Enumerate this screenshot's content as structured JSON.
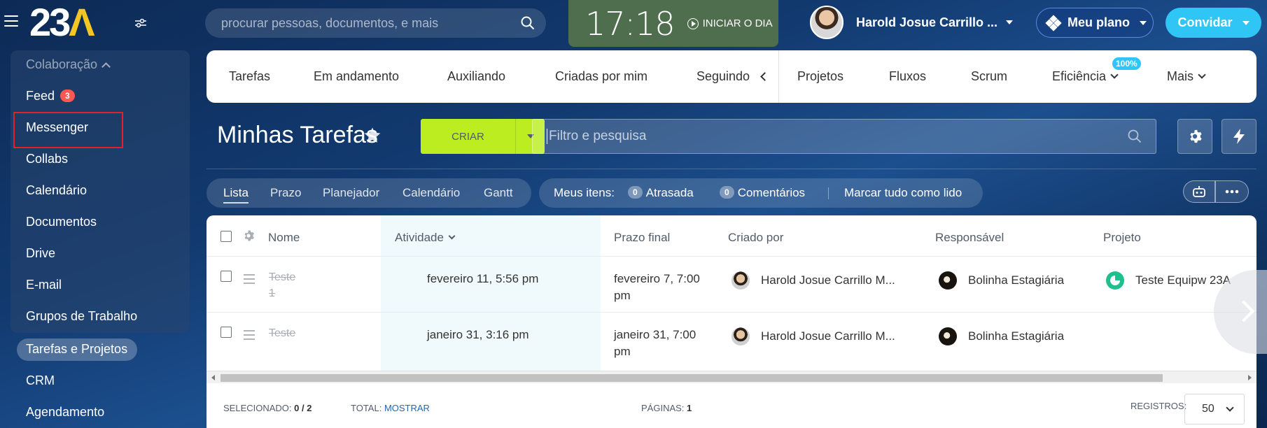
{
  "header": {
    "logo": {
      "main": "23",
      "accent": "Λ"
    },
    "search_placeholder": "procurar pessoas, documentos, e mais",
    "clock_time": "17:18",
    "start_day_label": "INICIAR O DIA",
    "user_name": "Harold Josue Carrillo ...",
    "plan_label": "Meu plano",
    "invite_label": "Convidar"
  },
  "sidebar": {
    "group_label": "Colaboração",
    "feed_label": "Feed",
    "feed_badge": "3",
    "items": [
      "Messenger",
      "Collabs",
      "Calendário",
      "Documentos",
      "Drive",
      "E-mail",
      "Grupos de Trabalho"
    ],
    "active_item": "Tarefas e Projetos",
    "below_items": [
      "CRM",
      "Agendamento"
    ]
  },
  "navbar": {
    "left_tabs": [
      "Tarefas",
      "Em andamento",
      "Auxiliando",
      "Criadas por mim",
      "Seguindo"
    ],
    "right_tabs": [
      "Projetos",
      "Fluxos",
      "Scrum"
    ],
    "efficiency_label": "Eficiência",
    "efficiency_badge": "100%",
    "more_label": "Mais"
  },
  "page": {
    "title": "Minhas Tarefas",
    "create_label": "CRIAR",
    "filter_placeholder": "Filtro e pesquisa"
  },
  "views": {
    "tabs": [
      "Lista",
      "Prazo",
      "Planejador",
      "Calendário",
      "Gantt"
    ],
    "active": "Lista"
  },
  "counters": {
    "label": "Meus itens:",
    "overdue_count": "0",
    "overdue_label": "Atrasada",
    "comments_count": "0",
    "comments_label": "Comentários",
    "mark_read_label": "Marcar tudo como lido"
  },
  "table": {
    "headers": {
      "name": "Nome",
      "activity": "Atividade",
      "deadline": "Prazo final",
      "created_by": "Criado por",
      "responsible": "Responsável",
      "project": "Projeto"
    },
    "rows": [
      {
        "name_line1": "Teste",
        "name_line2": "1",
        "activity": "fevereiro 11, 5:56 pm",
        "deadline_line1": "fevereiro 7, 7:00",
        "deadline_line2": "pm",
        "created_by": "Harold Josue Carrillo M...",
        "responsible": "Bolinha Estagiária",
        "project": "Teste Equipw 23A"
      },
      {
        "name_line1": "Teste",
        "name_line2": "",
        "activity": "janeiro 31, 3:16 pm",
        "deadline_line1": "janeiro 31, 7:00",
        "deadline_line2": "pm",
        "created_by": "Harold Josue Carrillo M...",
        "responsible": "Bolinha Estagiária",
        "project": ""
      }
    ]
  },
  "footer": {
    "selected_label": "SELECIONADO:",
    "selected_value": "0 / 2",
    "total_label": "TOTAL:",
    "total_link": "MOSTRAR",
    "pages_label": "PÁGINAS:",
    "pages_value": "1",
    "records_label": "REGISTROS:",
    "records_value": "50"
  },
  "colors": {
    "accent_green": "#bbed21",
    "invite_blue": "#2fc6f6",
    "badge_red": "#ff5752",
    "highlight_red": "#e0202b"
  }
}
